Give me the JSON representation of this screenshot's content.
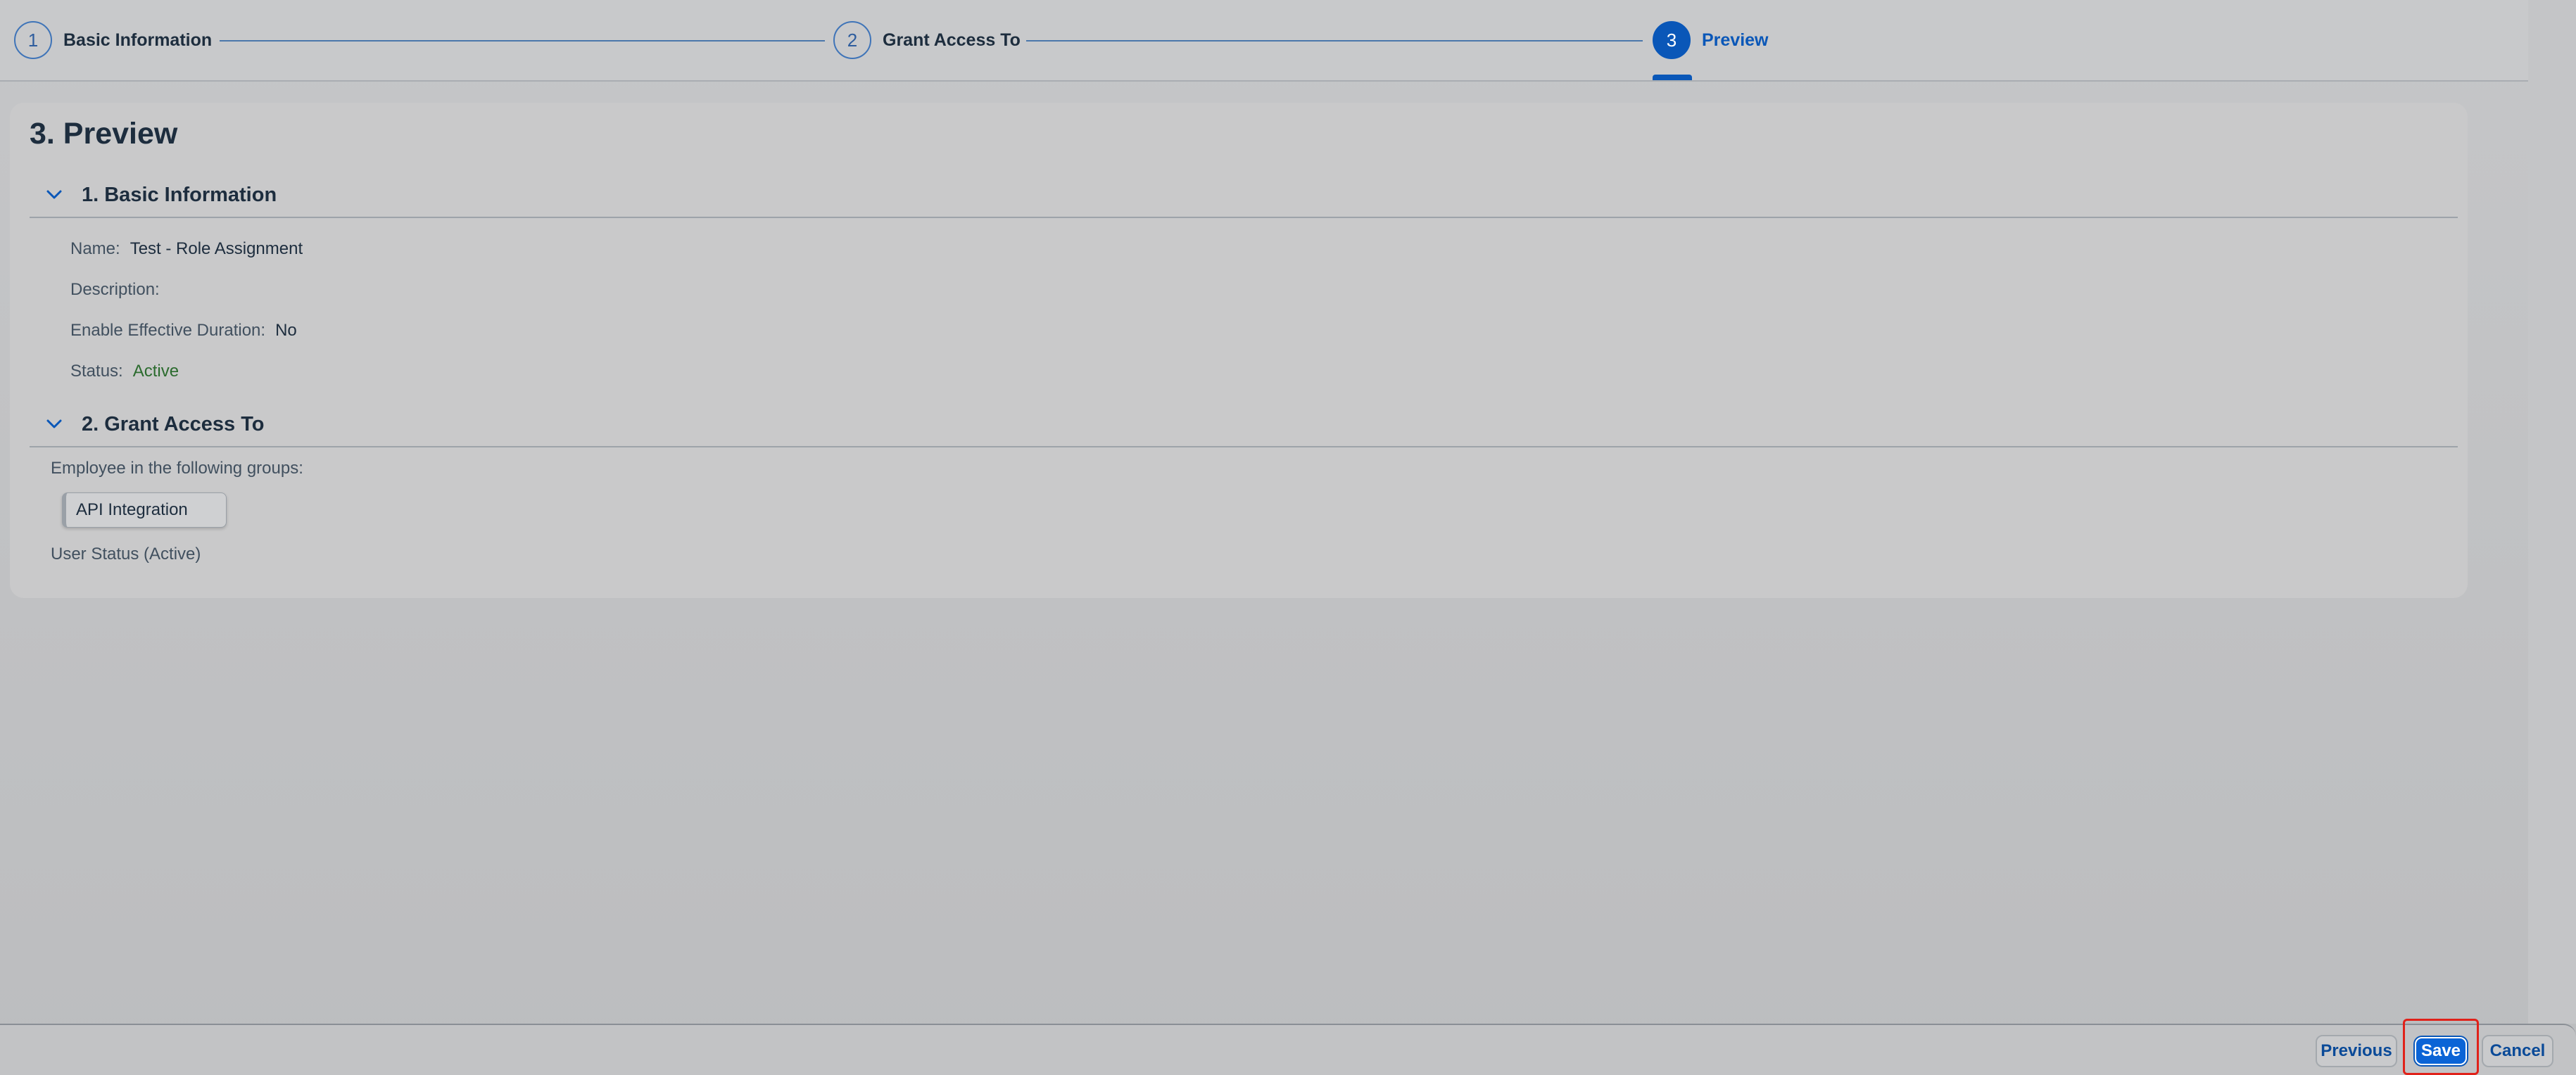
{
  "wizard": {
    "steps": [
      {
        "number": "1",
        "title": "Basic Information",
        "state": "completed"
      },
      {
        "number": "2",
        "title": "Grant Access To",
        "state": "completed"
      },
      {
        "number": "3",
        "title": "Preview",
        "state": "active"
      }
    ]
  },
  "preview": {
    "title": "3. Preview",
    "basic_information": {
      "heading": "1. Basic Information",
      "fields": [
        {
          "label": "Name:",
          "value": "Test - Role Assignment"
        },
        {
          "label": "Description:",
          "value": ""
        },
        {
          "label": "Enable Effective Duration:",
          "value": "No"
        },
        {
          "label": "Status:",
          "value": "Active"
        }
      ]
    },
    "grant_access": {
      "heading": "2. Grant Access To",
      "groups_label": "Employee in the following groups:",
      "groups": [
        "API Integration"
      ],
      "user_status": "User Status (Active)"
    }
  },
  "footer": {
    "previous_label": "Previous",
    "save_label": "Save",
    "cancel_label": "Cancel"
  },
  "colors": {
    "accent": "#0a57b8",
    "positive": "#2b6b2e",
    "highlight": "#e0221a"
  }
}
